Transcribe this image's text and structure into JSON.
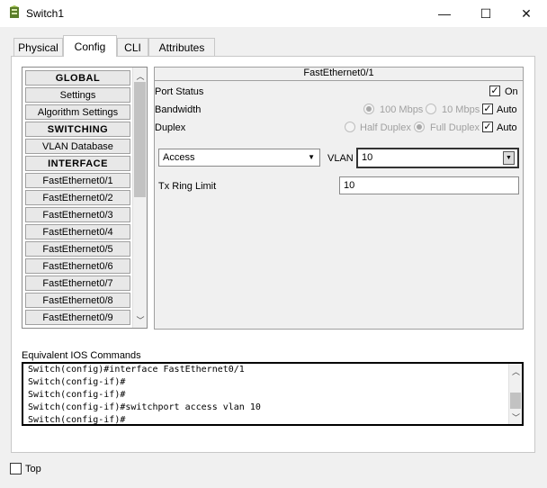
{
  "window": {
    "title": "Switch1",
    "minimize": "—",
    "maximize": "☐",
    "close": "✕"
  },
  "tabs": [
    {
      "label": "Physical",
      "active": false
    },
    {
      "label": "Config",
      "active": true
    },
    {
      "label": "CLI",
      "active": false
    },
    {
      "label": "Attributes",
      "active": false
    }
  ],
  "sidebar": {
    "items": [
      {
        "label": "GLOBAL",
        "header": true
      },
      {
        "label": "Settings",
        "header": false
      },
      {
        "label": "Algorithm Settings",
        "header": false
      },
      {
        "label": "SWITCHING",
        "header": true
      },
      {
        "label": "VLAN Database",
        "header": false
      },
      {
        "label": "INTERFACE",
        "header": true
      },
      {
        "label": "FastEthernet0/1",
        "header": false
      },
      {
        "label": "FastEthernet0/2",
        "header": false
      },
      {
        "label": "FastEthernet0/3",
        "header": false
      },
      {
        "label": "FastEthernet0/4",
        "header": false
      },
      {
        "label": "FastEthernet0/5",
        "header": false
      },
      {
        "label": "FastEthernet0/6",
        "header": false
      },
      {
        "label": "FastEthernet0/7",
        "header": false
      },
      {
        "label": "FastEthernet0/8",
        "header": false
      },
      {
        "label": "FastEthernet0/9",
        "header": false
      }
    ]
  },
  "interface": {
    "title": "FastEthernet0/1",
    "port_status_label": "Port Status",
    "on_label": "On",
    "on_checked": true,
    "bandwidth_label": "Bandwidth",
    "bw_100": "100 Mbps",
    "bw_10": "10 Mbps",
    "bw_auto": "Auto",
    "bw_auto_checked": true,
    "duplex_label": "Duplex",
    "half_duplex": "Half Duplex",
    "full_duplex": "Full Duplex",
    "duplex_auto": "Auto",
    "duplex_auto_checked": true,
    "mode_value": "Access",
    "vlan_label": "VLAN",
    "vlan_value": "10",
    "tx_ring_label": "Tx Ring Limit",
    "tx_ring_value": "10"
  },
  "ios": {
    "label": "Equivalent IOS Commands",
    "lines": [
      "Switch(config)#interface FastEthernet0/1",
      "Switch(config-if)#",
      "Switch(config-if)#",
      "Switch(config-if)#switchport access vlan 10",
      "Switch(config-if)#"
    ]
  },
  "footer": {
    "top_label": "Top",
    "top_checked": false
  },
  "icons": {
    "app": "switch-app-icon",
    "check": "✓",
    "dropdown": "▼",
    "up": "︿",
    "down": "﹀"
  }
}
